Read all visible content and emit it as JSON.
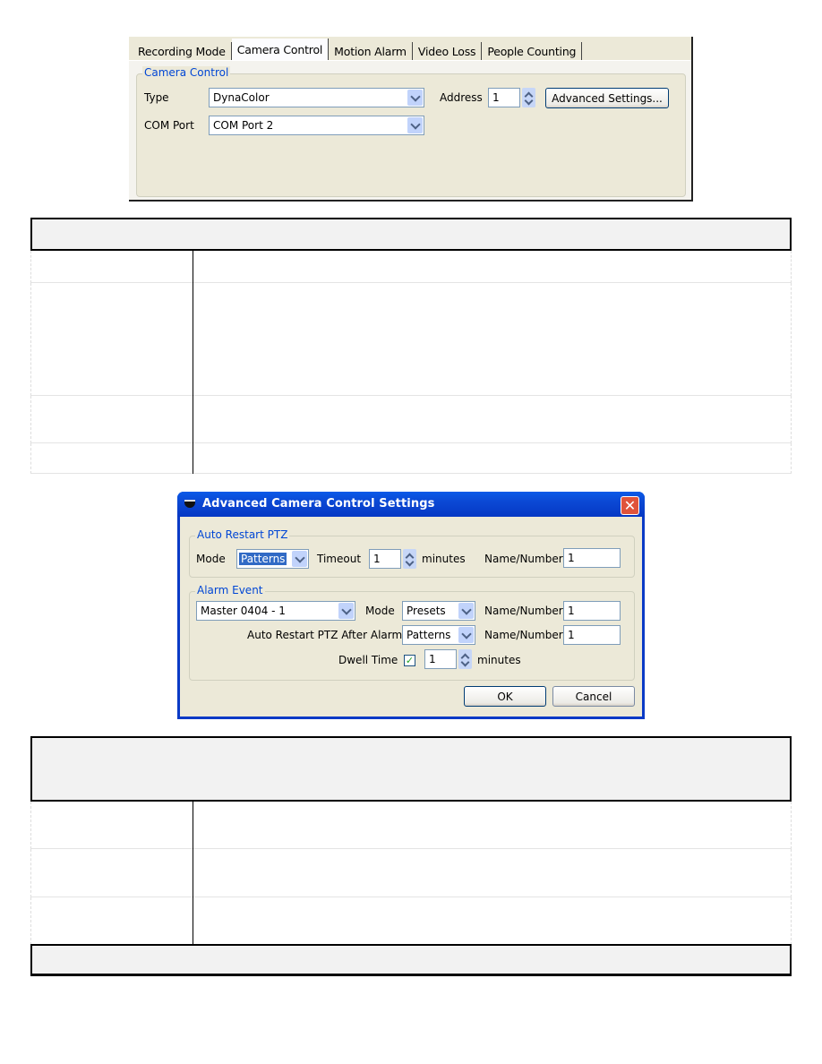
{
  "camera_control_panel": {
    "tabs": [
      {
        "label": "Recording Mode",
        "active": false
      },
      {
        "label": "Camera Control",
        "active": true
      },
      {
        "label": "Motion Alarm",
        "active": false
      },
      {
        "label": "Video Loss",
        "active": false
      },
      {
        "label": "People Counting",
        "active": false
      }
    ],
    "group_title": "Camera Control",
    "type_label": "Type",
    "type_value": "DynaColor",
    "com_port_label": "COM Port",
    "com_port_value": "COM Port 2",
    "address_label": "Address",
    "address_value": "1",
    "advanced_button": "Advanced Settings..."
  },
  "table1": {
    "header": "",
    "rows": [
      {
        "label": "",
        "description": ""
      },
      {
        "label": "",
        "description": ""
      },
      {
        "label": "",
        "description": ""
      },
      {
        "label": "",
        "description": ""
      }
    ]
  },
  "advanced_dialog": {
    "title": "Advanced Camera Control Settings",
    "close_symbol": "✕",
    "auto_restart": {
      "group_title": "Auto Restart PTZ",
      "mode_label": "Mode",
      "mode_value": "Patterns",
      "timeout_label": "Timeout",
      "timeout_value": "1",
      "minutes_label": "minutes",
      "name_number_label": "Name/Number",
      "name_number_value": "1"
    },
    "alarm_event": {
      "group_title": "Alarm Event",
      "event_value": "Master 0404 - 1",
      "mode_label": "Mode",
      "mode_value": "Presets",
      "name_number_label": "Name/Number",
      "name_number_value": "1",
      "after_alarm_label": "Auto Restart PTZ After Alarm",
      "after_alarm_value": "Patterns",
      "after_alarm_name_label": "Name/Number",
      "after_alarm_name_value": "1",
      "dwell_label": "Dwell Time",
      "dwell_checked": true,
      "dwell_check_symbol": "✓",
      "dwell_value": "1",
      "dwell_minutes_label": "minutes"
    },
    "ok_button": "OK",
    "cancel_button": "Cancel"
  },
  "table2": {
    "header": "",
    "rows": [
      {
        "label": "",
        "description": ""
      },
      {
        "label": "",
        "description": ""
      },
      {
        "label": "",
        "description": ""
      }
    ],
    "footer": ""
  }
}
